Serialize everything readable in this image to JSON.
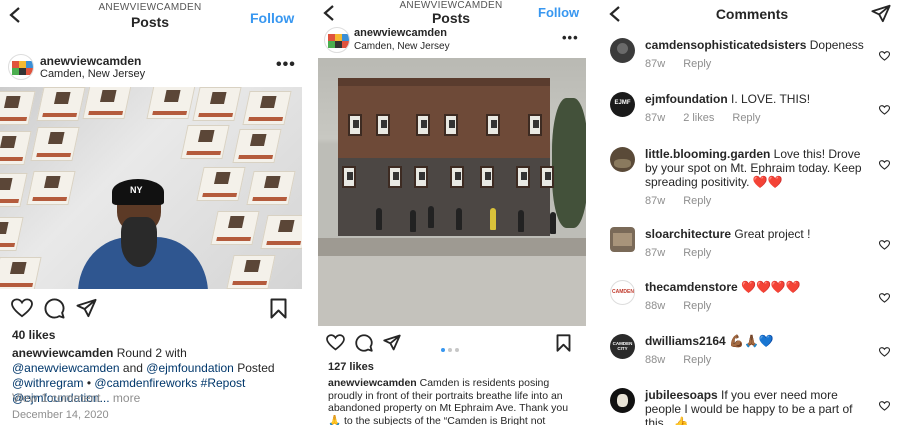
{
  "post1": {
    "header_small": "ANEWVIEWCAMDEN",
    "header_title": "Posts",
    "follow": "Follow",
    "username": "anewviewcamden",
    "location": "Camden, New Jersey",
    "posters": [
      "CAMDEN IS...",
      "CAMDEN IS... UNIQUE",
      "CAMDEN IS... REVOLUTIONARY",
      "CAMDEN IS... BEAUTIFUL",
      "CAMDEN IS... PROUD",
      "CAMDEN IS... WORTHY",
      "CAMDEN IS... ECCENTRIC",
      "CAMDEN IS... MY MUSE",
      "CAMDEN IS... COMPASS",
      "CAMDEN IS... HEALING",
      "CAMDEN IS... INDOMITABLE",
      "CAMDEN IS..."
    ],
    "cap_text": "NY",
    "likes": "40 likes",
    "caption_user": "anewviewcamden",
    "caption_t1": " Round 2 with ",
    "caption_l1": "@anewviewcamden",
    "caption_t2": " and ",
    "caption_l2": "@ejmfoundation",
    "caption_t3": " Posted ",
    "caption_l3": "@withregram",
    "caption_t4": " • ",
    "caption_l4": "@camdenfireworks",
    "caption_t5": " ",
    "caption_l5": "#Repost",
    "caption_t6": " ",
    "caption_l6": "@ejmfoundation...",
    "more": " more",
    "view_comments": "View 1 comment",
    "date": "December 14, 2020"
  },
  "post2": {
    "header_small": "ANEWVIEWCAMDEN",
    "header_title": "Posts",
    "follow": "Follow",
    "username": "anewviewcamden",
    "location": "Camden, New Jersey",
    "likes": "127 likes",
    "caption_user": "anewviewcamden",
    "caption_text": " Camden is residents posing proudly in front of their portraits breathe life into an abandoned property on Mt Ephraim Ave. Thank you 🙏 to the subjects of the “Camden is Bright not"
  },
  "comments_panel": {
    "title": "Comments",
    "comments": [
      {
        "user": "camdensophisticatedsisters",
        "text": " Dopeness",
        "time": "87w",
        "likes": "",
        "reply": "Reply",
        "avatar_color": "#3b3b3b"
      },
      {
        "user": "ejmfoundation",
        "text": " I. LOVE. THIS!",
        "time": "87w",
        "likes": "2 likes",
        "reply": "Reply",
        "avatar_color": "#1a1a1a",
        "avatar_text": "EJMF"
      },
      {
        "user": "little.blooming.garden",
        "text": " Love this! Drove by your spot on Mt. Ephraim today. Keep spreading positivity. ❤️❤️",
        "time": "87w",
        "likes": "",
        "reply": "Reply",
        "avatar_color": "#5a4a38"
      },
      {
        "user": "sloarchitecture",
        "text": " Great project !",
        "time": "87w",
        "likes": "",
        "reply": "Reply",
        "avatar_color": "#7a6a58"
      },
      {
        "user": "thecamdenstore",
        "text": " ❤️❤️❤️❤️",
        "time": "88w",
        "likes": "",
        "reply": "Reply",
        "avatar_color": "#ffffff",
        "avatar_text": "CAMDEN"
      },
      {
        "user": "dwilliams2164",
        "text": " 💪🏾🙏🏾💙",
        "time": "88w",
        "likes": "",
        "reply": "Reply",
        "avatar_color": "#2a2a2a",
        "avatar_text": "CAMDEN CITY"
      },
      {
        "user": "jubileesoaps",
        "text": " If you ever need more people I would be happy to be a part of this . 👍",
        "time": "",
        "likes": "",
        "reply": "",
        "avatar_color": "#111111"
      }
    ]
  },
  "colors": {
    "link": "#00376b",
    "follow": "#3897f0",
    "heart": "#e0245e"
  },
  "icons": [
    "back-arrow-icon",
    "more-options-icon",
    "heart-icon",
    "comment-icon",
    "share-icon",
    "bookmark-icon",
    "direct-message-icon"
  ]
}
